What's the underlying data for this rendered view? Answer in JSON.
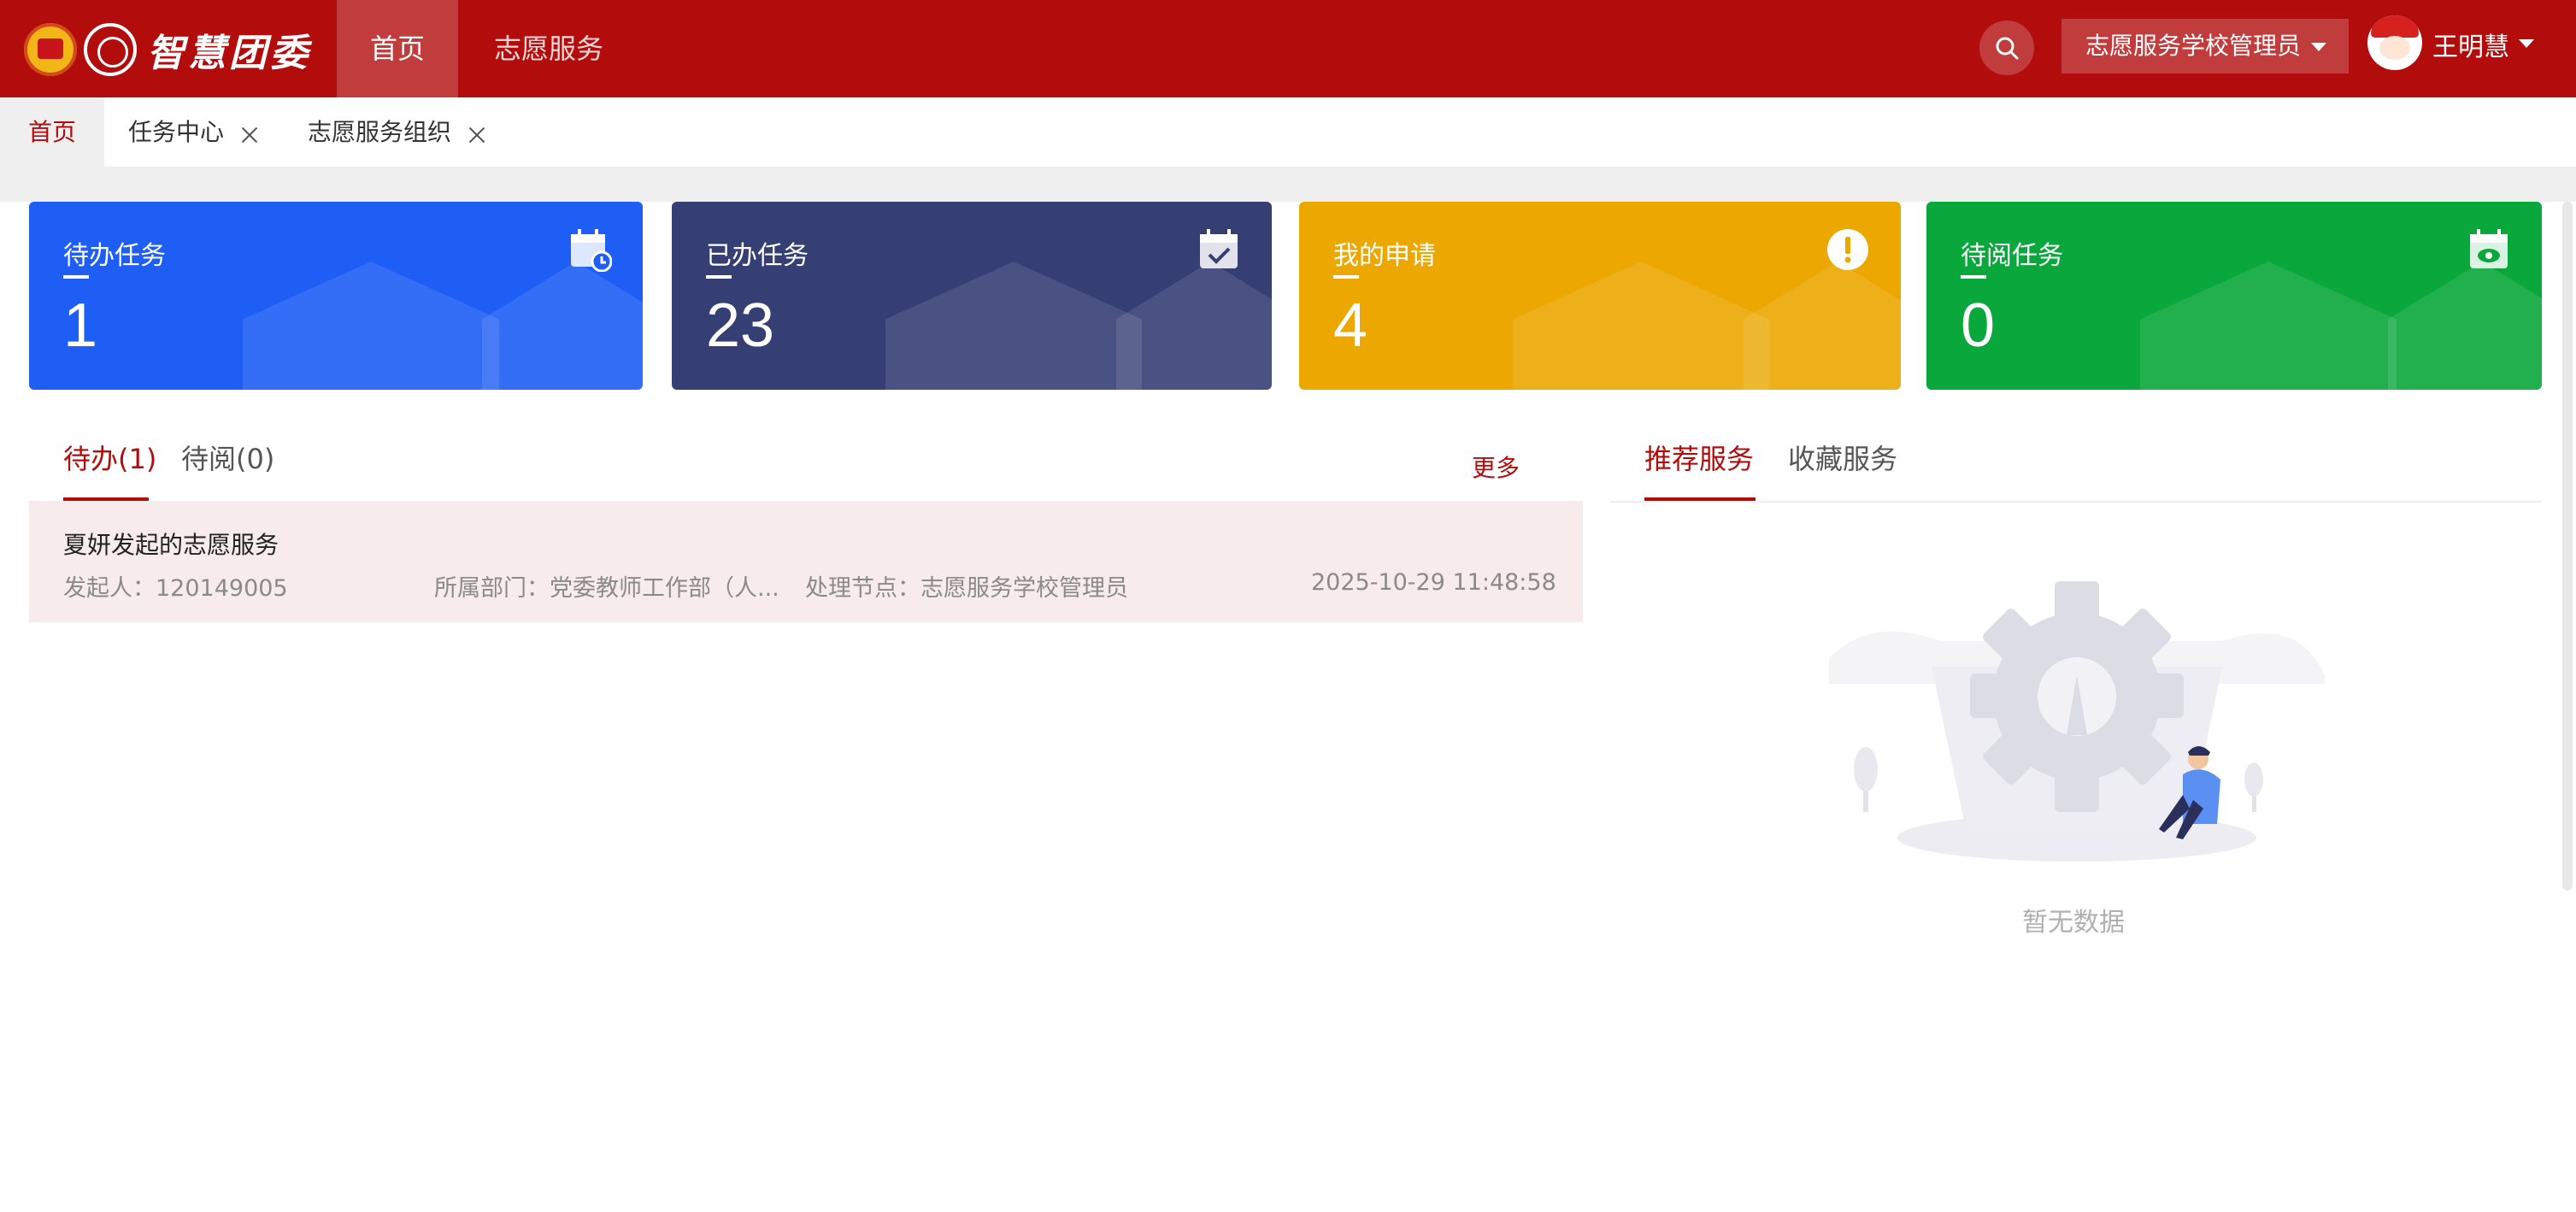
{
  "header": {
    "logo_text": "智慧团委",
    "nav": [
      {
        "label": "首页",
        "active": true
      },
      {
        "label": "志愿服务",
        "active": false
      }
    ],
    "role": "志愿服务学校管理员",
    "user_name": "王明慧"
  },
  "tabs": [
    {
      "label": "首页",
      "active": true,
      "closable": false
    },
    {
      "label": "任务中心",
      "active": false,
      "closable": true
    },
    {
      "label": "志愿服务组织",
      "active": false,
      "closable": true
    }
  ],
  "cards": [
    {
      "label": "待办任务",
      "value": "1",
      "color": "#1e5ef5",
      "icon": "calendar-clock-icon"
    },
    {
      "label": "已办任务",
      "value": "23",
      "color": "#353f74",
      "icon": "calendar-check-icon"
    },
    {
      "label": "我的申请",
      "value": "4",
      "color": "#eca700",
      "icon": "exclamation-icon"
    },
    {
      "label": "待阅任务",
      "value": "0",
      "color": "#0aa73c",
      "icon": "calendar-eye-icon"
    }
  ],
  "todo_panel": {
    "tabs": [
      {
        "label": "待办(1)",
        "active": true
      },
      {
        "label": "待阅(0)",
        "active": false
      }
    ],
    "more_label": "更多",
    "items": [
      {
        "title": "夏妍发起的志愿服务",
        "initiator": "发起人：120149005",
        "department": "所属部门：党委教师工作部（人...",
        "node": "处理节点：志愿服务学校管理员",
        "time": "2025-10-29 11:48:58"
      }
    ]
  },
  "service_panel": {
    "tabs": [
      {
        "label": "推荐服务",
        "active": true
      },
      {
        "label": "收藏服务",
        "active": false
      }
    ],
    "empty_text": "暂无数据"
  },
  "colors": {
    "brand": "#b20c0c",
    "todo_row_bg": "#f7ebeb"
  }
}
